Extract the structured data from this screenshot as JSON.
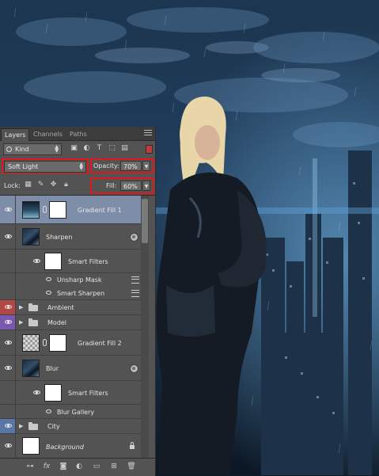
{
  "panel": {
    "tabs": [
      "Layers",
      "Channels",
      "Paths"
    ],
    "filter_kind": "Kind",
    "blend_mode": "Soft Light",
    "opacity_label": "Opacity:",
    "opacity_value": "70%",
    "lock_label": "Lock:",
    "fill_label": "Fill:",
    "fill_value": "60%"
  },
  "layers": [
    {
      "name": "Gradient Fill 1",
      "selected": true
    },
    {
      "name": "Sharpen"
    },
    {
      "name": "Smart Filters"
    },
    {
      "name": "Unsharp Mask"
    },
    {
      "name": "Smart Sharpen"
    },
    {
      "name": "Ambient",
      "eye_color": "#b24746"
    },
    {
      "name": "Model",
      "eye_color": "#7a57b0"
    },
    {
      "name": "Gradient Fill 2"
    },
    {
      "name": "Blur"
    },
    {
      "name": "Smart Filters"
    },
    {
      "name": "Blur Gallery"
    },
    {
      "name": "City",
      "eye_color": "#5a76a6"
    },
    {
      "name": "Background"
    }
  ],
  "colors": {
    "highlight_box": "#e3161c",
    "selected_row": "#7e8ea8",
    "panel_bg": "#535353"
  }
}
